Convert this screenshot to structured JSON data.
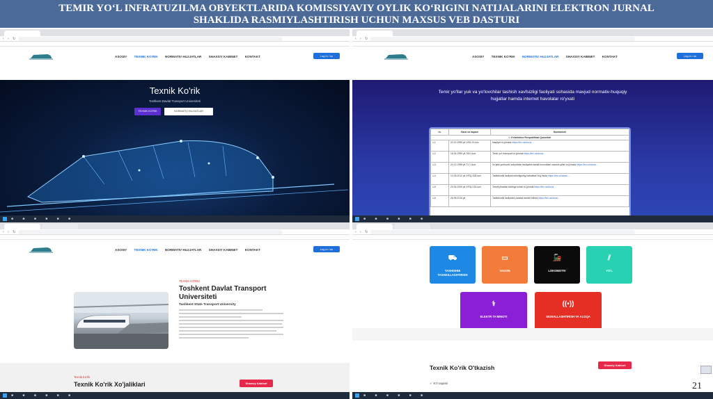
{
  "title_line1": "TEMIR YO‘L INFRATUZILMA OBYEKTLARIDA KOMISSIYAVIY OYLIK KO‘RIGINI NATIJALARINI ELEKTRON JURNAL",
  "title_line2": "SHAKLIDA RASMIYLASHTIRISH UCHUN MAXSUS VEB DASTURI",
  "page_number": "21",
  "nav": {
    "items": [
      "ASOSIY",
      "TEXNIK KO'RIK",
      "NORMATIV HUJJATLAR",
      "SHAXSIY KABINET",
      "KONTAKT"
    ],
    "login": "Log in / sn"
  },
  "hero": {
    "title": "Texnik Ko'rik",
    "subtitle": "Toshkent Davlat Transport Universiteti",
    "btn_primary": "TEXNIK KO'RIK",
    "btn_secondary": "NORMATIV HUJJATLAR"
  },
  "docs": {
    "heading_line1": "Temir yo'llar yuk va yo'lovchilar tashish xavfsizligi faoliyati sohasida mavjud normativ-huquqiy",
    "heading_line2": "hujjatlar hamda internet havolalar ro'yxati",
    "columns": [
      "№",
      "Sana va raqami",
      "Nomlanishi"
    ],
    "section": "I. O'zbekiston Respublikasi Qonunlari",
    "rows": [
      {
        "num": "1.1",
        "date": "22.12.1995 yil 1092-XI-son",
        "name": "Naqliyot to'g'risida",
        "link": "https://lex.uz/docs/..."
      },
      {
        "num": "1.2",
        "date": "15.04.1999 yil 759-I-son",
        "name": "Temir yo'l transporti to'g'risida",
        "link": "https://lex.uz/docs/..."
      },
      {
        "num": "1.3",
        "date": "24.12.1998 yil 717-I-son",
        "name": "Xo'jalik yurituvchi subyektlar faoliyatini davlat tomonidan nazorat qilish to'g'risida",
        "link": "https://lex.uz/docs/..."
      },
      {
        "num": "1.4",
        "date": "10.05.2012 yil O'RQ-328-son",
        "name": "Tadbirkorlik faoliyati erkinligining kafolatlari to'g'risida",
        "link": "https://lex.uz/docs/..."
      },
      {
        "num": "1.5",
        "date": "23.04.2009 yil O'RQ-215-son",
        "name": "Texnik jihatdan tartibga solish to'g'risida",
        "link": "https://lex.uz/docs/..."
      },
      {
        "num": "1.6",
        "date": "26.05.2015 yil",
        "name": "Tadbirkorlik faoliyatini yanada tashkil etilishi",
        "link": "https://lex.uz/docs/..."
      }
    ]
  },
  "about": {
    "label": "TEXNIK KO'RIK",
    "title": "Toshkent Davlat Transport Universiteti",
    "subtitle": "Tashkent State Transport University",
    "band_label": "Texnik Ko'rik",
    "band_title": "Texnik Ko'rik Xo'jaliklari",
    "button": "Shaxsiy Kabinet"
  },
  "categories": [
    {
      "label": "TASHISHNI TASHKILLASHTIRISH",
      "icon": "truck-icon",
      "color": "#1e88e5"
    },
    {
      "label": "VAGON",
      "icon": "wagon-icon",
      "color": "#f37c3a"
    },
    {
      "label": "LOKOMOTIV",
      "icon": "train-icon",
      "color": "#0b0b0b"
    },
    {
      "label": "YO'L",
      "icon": "rail-icon",
      "color": "#28d1b2"
    },
    {
      "label": "ELEKTR TA'MINOTI",
      "icon": "power-icon",
      "color": "#8a1fd6"
    },
    {
      "label": "SIGNALLASHTIRISH VA ALOQA",
      "icon": "signal-icon",
      "color": "#e52f24"
    }
  ],
  "checkup": {
    "title": "Texnik Ko'rik O'tkazish",
    "button": "Shaxsiy Kabinet",
    "row": "Yo'l raqami"
  }
}
